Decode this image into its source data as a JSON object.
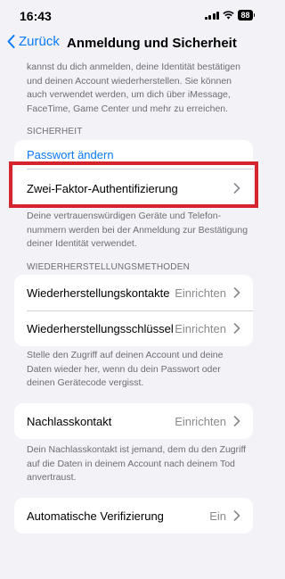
{
  "status": {
    "time": "16:43",
    "battery": "88"
  },
  "nav": {
    "back_label": "Zurück",
    "title": "Anmeldung und Sicherheit"
  },
  "top_note": "kannst du dich anmelden, deine Identität bestätigen und deinen Account wiederherstellen. Sie können auch verwendet werden, um dich über iMessage, FaceTime, Game Center und mehr zu erreichen.",
  "security": {
    "header": "SICHERHEIT",
    "change_password": "Passwort ändern",
    "two_factor": "Zwei-Faktor-Authentifizierung",
    "footer": "Deine vertrauenswürdigen Geräte und Telefon­nummern werden bei der Anmeldung zur Bestätigung deiner Identität verwendet."
  },
  "recovery": {
    "header": "WIEDERHERSTELLUNGSMETHODEN",
    "contacts_label": "Wiederherstellungskontakte",
    "contacts_value": "Einrichten",
    "key_label": "Wiederherstellungsschlüssel",
    "key_value": "Einrichten",
    "footer": "Stelle den Zugriff auf deinen Account und deine Daten wieder her, wenn du dein Passwort oder deinen Gerätecode vergisst."
  },
  "legacy": {
    "label": "Nachlasskontakt",
    "value": "Einrichten",
    "footer": "Dein Nachlasskontakt ist jemand, dem du den Zugriff auf die Daten in deinem Account nach deinem Tod anvertraust."
  },
  "verification": {
    "label": "Automatische Verifizierung",
    "value": "Ein"
  },
  "colors": {
    "accent": "#0a7aff",
    "highlight": "#d6242f",
    "background": "#f2f2f7"
  }
}
